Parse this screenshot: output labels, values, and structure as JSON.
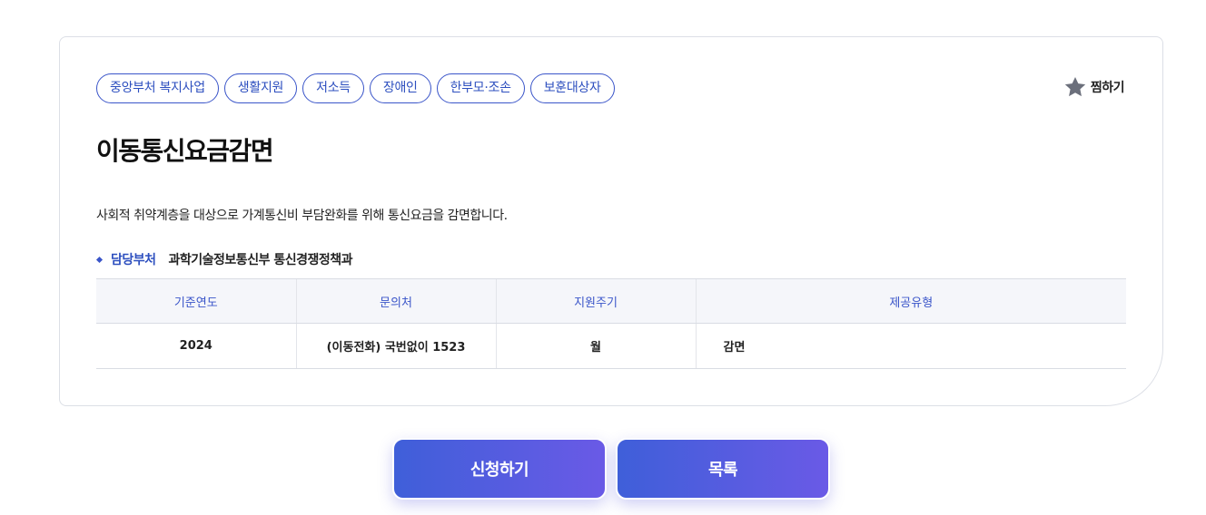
{
  "tags": [
    "중앙부처 복지사업",
    "생활지원",
    "저소득",
    "장애인",
    "한부모·조손",
    "보훈대상자"
  ],
  "favorite": {
    "label": "찜하기",
    "icon": "star-icon"
  },
  "title": "이동통신요금감면",
  "description": "사회적 취약계층을 대상으로 가계통신비 부담완화를 위해 통신요금을 감면합니다.",
  "department": {
    "label": "담당부처",
    "value": "과학기술정보통신부 통신경쟁정책과"
  },
  "table": {
    "headers": [
      "기준연도",
      "문의처",
      "지원주기",
      "제공유형"
    ],
    "row": [
      "2024",
      "(이동전화) 국번없이 1523",
      "월",
      "감면"
    ]
  },
  "buttons": {
    "apply": "신청하기",
    "list": "목록"
  },
  "colors": {
    "accent": "#3a55c9",
    "button_start": "#3f5fd9",
    "button_end": "#6a5ae6",
    "star": "#6b6f7b"
  }
}
